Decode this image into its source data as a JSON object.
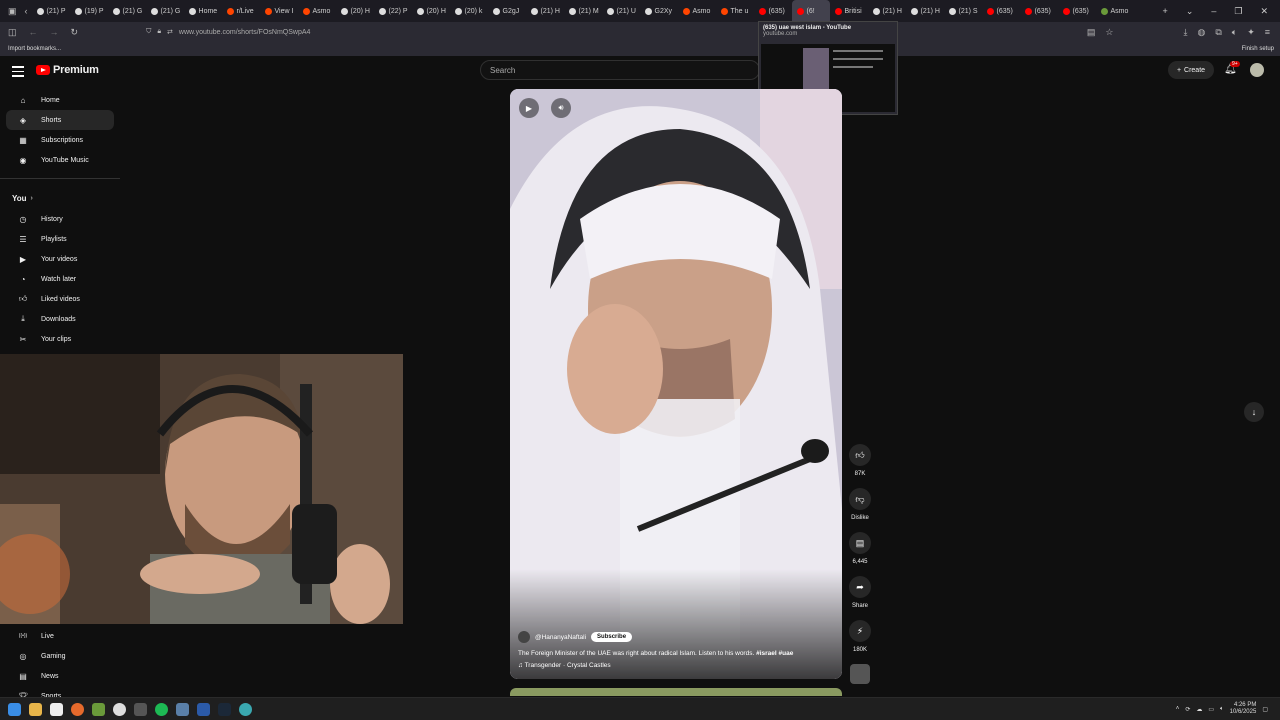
{
  "browser": {
    "tabs": [
      {
        "label": "(21) P",
        "color": "#000000"
      },
      {
        "label": "(19) P",
        "color": "#000000"
      },
      {
        "label": "(21) G",
        "color": "#000000"
      },
      {
        "label": "(21) G",
        "color": "#000000"
      },
      {
        "label": "Home",
        "color": "#000000"
      },
      {
        "label": "r/Live",
        "color": "#ff4500"
      },
      {
        "label": "View I",
        "color": "#ff4500"
      },
      {
        "label": "Asmo",
        "color": "#ff4500"
      },
      {
        "label": "(20) H",
        "color": "#000000"
      },
      {
        "label": "(22) P",
        "color": "#000000"
      },
      {
        "label": "(20) H",
        "color": "#000000"
      },
      {
        "label": "(20) k",
        "color": "#000000"
      },
      {
        "label": "G2gJ",
        "color": "#000000"
      },
      {
        "label": "(21) H",
        "color": "#000000"
      },
      {
        "label": "(21) M",
        "color": "#000000"
      },
      {
        "label": "(21) U",
        "color": "#000000"
      },
      {
        "label": "G2Xy",
        "color": "#000000"
      },
      {
        "label": "Asmo",
        "color": "#ff4500"
      },
      {
        "label": "The u",
        "color": "#ff4500"
      },
      {
        "label": "(635)",
        "color": "#ff0000"
      },
      {
        "label": "(6!",
        "color": "#ff0000"
      },
      {
        "label": "Britisi",
        "color": "#ff0000"
      },
      {
        "label": "(21) H",
        "color": "#000000"
      },
      {
        "label": "(21) H",
        "color": "#000000"
      },
      {
        "label": "(21) S",
        "color": "#000000"
      },
      {
        "label": "(635)",
        "color": "#ff0000"
      },
      {
        "label": "(635)",
        "color": "#ff0000"
      },
      {
        "label": "(635)",
        "color": "#ff0000"
      },
      {
        "label": "Asmo",
        "color": "#6a9a3a"
      }
    ],
    "url": "www.youtube.com/shorts/FOsNmQSwpA4",
    "bookmark_import": "Import bookmarks...",
    "finish_setup": "Finish setup",
    "tab_preview": {
      "title": "(635) uae west islam - YouTube",
      "domain": "youtube.com"
    }
  },
  "header": {
    "logo_text": "Premium",
    "search_placeholder": "Search",
    "create_label": "Create",
    "notification_count": "9+"
  },
  "sidebar": {
    "main": [
      {
        "label": "Home",
        "icon": "home-icon"
      },
      {
        "label": "Shorts",
        "icon": "shorts-icon"
      },
      {
        "label": "Subscriptions",
        "icon": "subscriptions-icon"
      },
      {
        "label": "YouTube Music",
        "icon": "music-icon"
      }
    ],
    "you_heading": "You",
    "you": [
      {
        "label": "History",
        "icon": "history-icon"
      },
      {
        "label": "Playlists",
        "icon": "playlists-icon"
      },
      {
        "label": "Your videos",
        "icon": "your-videos-icon"
      },
      {
        "label": "Watch later",
        "icon": "watch-later-icon"
      },
      {
        "label": "Liked videos",
        "icon": "liked-icon"
      },
      {
        "label": "Downloads",
        "icon": "downloads-icon"
      },
      {
        "label": "Your clips",
        "icon": "clips-icon"
      }
    ],
    "explore": [
      {
        "label": "Live",
        "icon": "live-icon"
      },
      {
        "label": "Gaming",
        "icon": "gaming-icon"
      },
      {
        "label": "News",
        "icon": "news-icon"
      },
      {
        "label": "Sports",
        "icon": "sports-icon"
      }
    ]
  },
  "short": {
    "channel": "@HananyaNaftali",
    "subscribe_label": "Subscribe",
    "description": "The Foreign Minister of the UAE was right about radical Islam. Listen to his words.",
    "hashtags": "#israel #uae",
    "music": "Transgender · Crystal Castles"
  },
  "actions": {
    "likes": "87K",
    "dislike_label": "Dislike",
    "comments": "6,445",
    "share_label": "Share",
    "remix_count": "180K"
  },
  "taskbar": {
    "time": "4:26 PM",
    "date": "10/6/2025"
  }
}
